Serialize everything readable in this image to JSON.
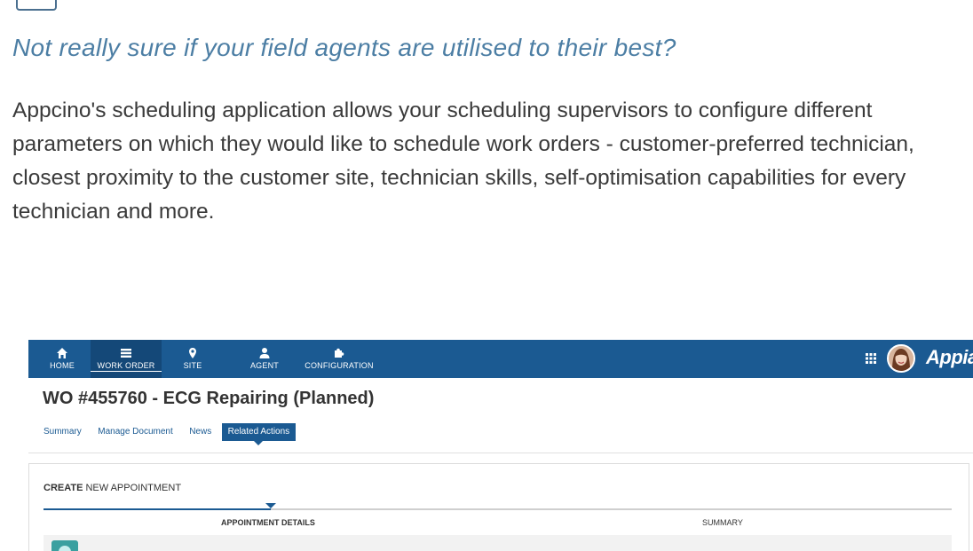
{
  "marketing": {
    "tagline": "Not really sure if your field agents are utilised to their best?",
    "description": "Appcino's scheduling application allows your scheduling supervisors to configure different parameters on which they would like to schedule work orders - customer-preferred technician, closest proximity to the customer site, technician skills, self-optimisation capabilities for every technician and more."
  },
  "app": {
    "nav": {
      "items": [
        {
          "label": "HOME",
          "icon": "home-icon"
        },
        {
          "label": "WORK ORDER",
          "icon": "list-icon",
          "active": true
        },
        {
          "label": "SITE",
          "icon": "map-pin-icon"
        },
        {
          "label": "AGENT",
          "icon": "user-icon"
        },
        {
          "label": "CONFIGURATION",
          "icon": "puzzle-icon"
        }
      ],
      "brand": "Appian"
    },
    "work_order": {
      "title": "WO #455760 - ECG Repairing (Planned)",
      "tabs": [
        "Summary",
        "Manage Document",
        "News",
        "Related Actions"
      ],
      "active_tab": "Related Actions"
    },
    "create_form": {
      "title_strong": "CREATE",
      "title_rest": " NEW APPOINTMENT",
      "steps": [
        "APPOINTMENT DETAILS",
        "SUMMARY"
      ],
      "current_step": 1,
      "progress_fraction": 0.25
    },
    "colors": {
      "nav_bg": "#1b5a92",
      "accent": "#1b5a92",
      "tagline": "#4c7ea4"
    }
  }
}
